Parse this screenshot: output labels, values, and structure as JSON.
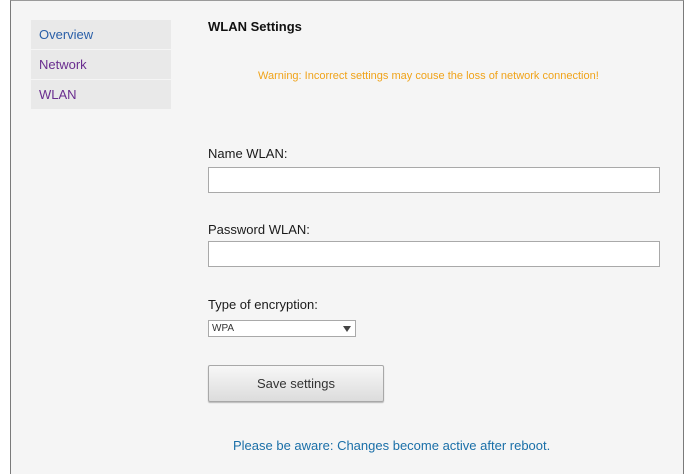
{
  "sidebar": {
    "items": [
      {
        "label": "Overview"
      },
      {
        "label": "Network"
      },
      {
        "label": "WLAN"
      }
    ]
  },
  "main": {
    "title": "WLAN Settings",
    "warning": "Warning: Incorrect settings may couse the loss of network connection!",
    "name_label": "Name WLAN:",
    "name_value": "",
    "password_label": "Password WLAN:",
    "password_value": "",
    "encryption_label": "Type of encryption:",
    "encryption_selected": "WPA",
    "save_label": "Save settings",
    "notice": "Please be aware:  Changes become active after reboot."
  },
  "colors": {
    "link": "#2a5fa8",
    "visited_link": "#6a2d8f",
    "warning": "#f0a319",
    "notice": "#1a6fa8"
  }
}
